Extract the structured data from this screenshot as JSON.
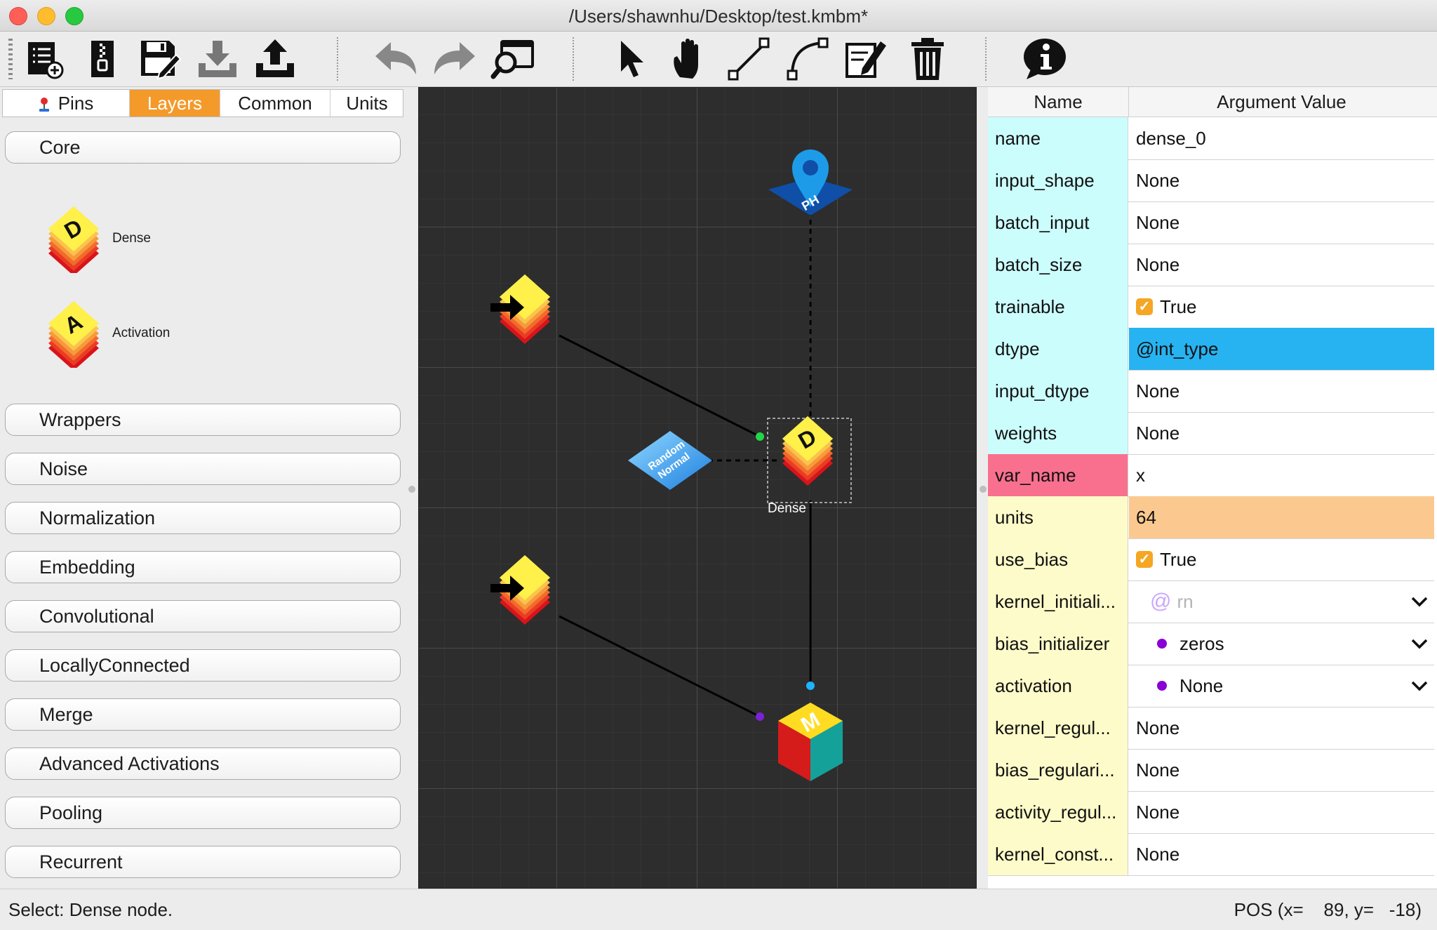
{
  "window": {
    "title": "/Users/shawnhu/Desktop/test.kmbm*"
  },
  "toolbar": {
    "buttons": [
      {
        "name": "new-file",
        "icon": "new-list-plus-icon"
      },
      {
        "name": "archive",
        "icon": "zip-icon"
      },
      {
        "name": "save",
        "icon": "save-edit-icon"
      },
      {
        "name": "import",
        "icon": "download-tray-icon"
      },
      {
        "name": "export",
        "icon": "upload-tray-icon"
      },
      {
        "name": "undo",
        "icon": "undo-icon"
      },
      {
        "name": "redo",
        "icon": "redo-icon"
      },
      {
        "name": "search",
        "icon": "search-window-icon"
      },
      {
        "name": "select",
        "icon": "cursor-arrow-icon"
      },
      {
        "name": "pan",
        "icon": "hand-icon"
      },
      {
        "name": "line",
        "icon": "line-tool-icon"
      },
      {
        "name": "curve",
        "icon": "curve-tool-icon"
      },
      {
        "name": "edit",
        "icon": "note-edit-icon"
      },
      {
        "name": "delete",
        "icon": "trash-icon"
      },
      {
        "name": "info",
        "icon": "info-icon"
      }
    ]
  },
  "left_panel": {
    "tabs": [
      {
        "label": "Pins",
        "active": false
      },
      {
        "label": "Layers",
        "active": true
      },
      {
        "label": "Common",
        "active": false
      },
      {
        "label": "Units",
        "active": false
      }
    ],
    "core_label": "Core",
    "core_items": [
      {
        "label": "Dense",
        "letter": "D"
      },
      {
        "label": "Activation",
        "letter": "A"
      }
    ],
    "sections": [
      "Wrappers",
      "Noise",
      "Normalization",
      "Embedding",
      "Convolutional",
      "LocallyConnected",
      "Merge",
      "Advanced Activations",
      "Pooling",
      "Recurrent"
    ]
  },
  "canvas": {
    "nodes": {
      "placeholder": {
        "text": "PH"
      },
      "input1": {
        "letter": ""
      },
      "input2": {
        "letter": ""
      },
      "random_normal": {
        "text1": "Random",
        "text2": "Normal"
      },
      "dense": {
        "letter": "D",
        "label": "Dense"
      },
      "model": {
        "letter": "M"
      }
    },
    "colors": {
      "grid": "#3d3d3d",
      "grid_major": "#4a4a4a",
      "edge": "#000000"
    }
  },
  "properties": {
    "headers": {
      "name": "Name",
      "value": "Argument Value"
    },
    "rows": [
      {
        "name": "name",
        "value": "dense_0",
        "name_bg": "cyan",
        "val_bg": "white"
      },
      {
        "name": "input_shape",
        "value": "None",
        "name_bg": "cyan",
        "val_bg": "white"
      },
      {
        "name": "batch_input",
        "value": "None",
        "name_bg": "cyan",
        "val_bg": "white"
      },
      {
        "name": "batch_size",
        "value": "None",
        "name_bg": "cyan",
        "val_bg": "white"
      },
      {
        "name": "trainable",
        "value": "True",
        "name_bg": "cyan",
        "val_bg": "white",
        "kind": "checkbox"
      },
      {
        "name": "dtype",
        "value": "@int_type",
        "name_bg": "cyan",
        "val_bg": "blue"
      },
      {
        "name": "input_dtype",
        "value": "None",
        "name_bg": "cyan",
        "val_bg": "white"
      },
      {
        "name": "weights",
        "value": "None",
        "name_bg": "cyan",
        "val_bg": "white"
      },
      {
        "name": "var_name",
        "value": "x",
        "name_bg": "pink",
        "val_bg": "white"
      },
      {
        "name": "units",
        "value": "64",
        "name_bg": "yellow",
        "val_bg": "orange"
      },
      {
        "name": "use_bias",
        "value": "True",
        "name_bg": "yellow",
        "val_bg": "white",
        "kind": "checkbox"
      },
      {
        "name": "kernel_initiali...",
        "value": "rn",
        "name_bg": "yellow",
        "val_bg": "white",
        "kind": "ref-dropdown"
      },
      {
        "name": "bias_initializer",
        "value": "zeros",
        "name_bg": "yellow",
        "val_bg": "white",
        "kind": "dot-dropdown"
      },
      {
        "name": "activation",
        "value": "None",
        "name_bg": "yellow",
        "val_bg": "white",
        "kind": "dot-dropdown"
      },
      {
        "name": "kernel_regul...",
        "value": "None",
        "name_bg": "yellow",
        "val_bg": "white"
      },
      {
        "name": "bias_regulari...",
        "value": "None",
        "name_bg": "yellow",
        "val_bg": "white"
      },
      {
        "name": "activity_regul...",
        "value": "None",
        "name_bg": "yellow",
        "val_bg": "white"
      },
      {
        "name": "kernel_const...",
        "value": "None",
        "name_bg": "yellow",
        "val_bg": "white"
      }
    ]
  },
  "status": {
    "message": "Select: Dense node.",
    "position": "POS (x=    89, y=   -18)"
  }
}
